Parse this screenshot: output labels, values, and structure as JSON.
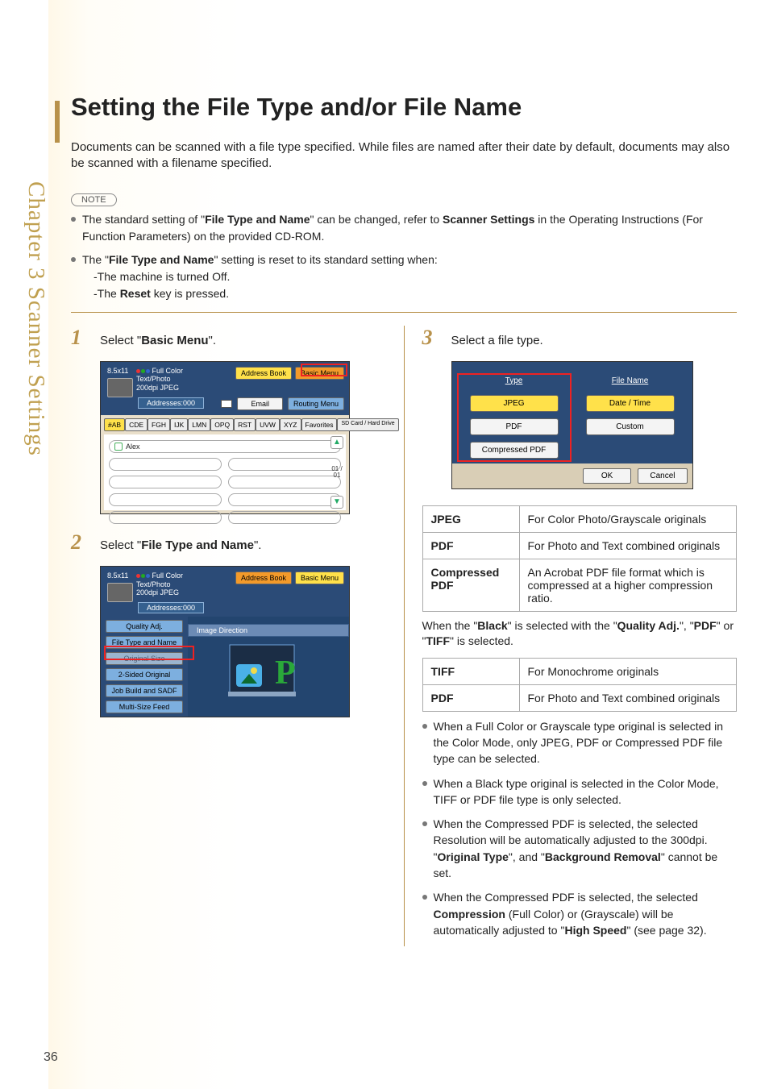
{
  "sidebar": "Chapter 3  Scanner Settings",
  "title": "Setting the File Type and/or File Name",
  "intro": "Documents can be scanned with a file type specified. While files are named after their date by default, documents may also be scanned with a filename specified.",
  "note_label": "NOTE",
  "notes": [
    {
      "text_pre": "The standard setting of \"",
      "b1": "File Type and Name",
      "text_mid": "\" can be changed, refer to ",
      "b2": "Scanner Settings",
      "text_post": " in the Operating Instructions (For Function Parameters) on the provided CD-ROM."
    },
    {
      "text_pre": "The \"",
      "b1": "File Type and Name",
      "text_mid": "\" setting is reset to its standard setting when:",
      "subs": [
        "-The machine is turned Off.",
        {
          "pre": "-The ",
          "b": "Reset",
          "post": " key is pressed."
        }
      ]
    }
  ],
  "steps": {
    "s1_num": "1",
    "s1_pre": "Select \"",
    "s1_bold": "Basic Menu",
    "s1_post": "\".",
    "s2_num": "2",
    "s2_pre": "Select \"",
    "s2_bold": "File Type and Name",
    "s2_post": "\".",
    "s3_num": "3",
    "s3_text": "Select a file type."
  },
  "ui1": {
    "size": "8.5x11",
    "full_color": "Full Color",
    "text_photo": "Text/Photo",
    "dpi": "200dpi JPEG",
    "addresses": "Addresses:000",
    "address_book": "Address Book",
    "basic_menu": "Basic Menu",
    "email": "Email",
    "routing_menu": "Routing Menu",
    "tabs": [
      "#AB",
      "CDE",
      "FGH",
      "IJK",
      "LMN",
      "OPQ",
      "RST",
      "UVW",
      "XYZ",
      "Favorites",
      "SD Card / Hard Drive"
    ],
    "row_name": "Alex",
    "page_ind": "01 / 01"
  },
  "ui2": {
    "size": "8.5x11",
    "full_color": "Full Color",
    "text_photo": "Text/Photo",
    "dpi": "200dpi JPEG",
    "addresses": "Addresses:000",
    "address_book": "Address Book",
    "basic_menu": "Basic Menu",
    "image_direction": "Image Direction",
    "menu": [
      "Quality Adj.",
      "File Type and Name",
      "Original Size",
      "2-Sided Original",
      "Job Build and SADF",
      "Multi-Size Feed"
    ]
  },
  "ui3": {
    "type_head": "Type",
    "filename_head": "File Name",
    "jpeg": "JPEG",
    "datetime": "Date / Time",
    "pdf": "PDF",
    "custom": "Custom",
    "cpdf": "Compressed PDF",
    "ok": "OK",
    "cancel": "Cancel"
  },
  "table1": [
    {
      "h": "JPEG",
      "d": "For Color Photo/Grayscale originals"
    },
    {
      "h": "PDF",
      "d": "For Photo and Text combined originals"
    },
    {
      "h": "Compressed PDF",
      "d": "An Acrobat PDF file format which is compressed at a higher compression ratio."
    }
  ],
  "mid_note": {
    "pre": "When the \"",
    "b1": "Black",
    "mid1": "\" is selected with the \"",
    "b2": "Quality Adj.",
    "mid2": "\", \"",
    "b3": "PDF",
    "mid3": "\" or \"",
    "b4": "TIFF",
    "post": "\" is selected."
  },
  "table2": [
    {
      "h": "TIFF",
      "d": "For Monochrome originals"
    },
    {
      "h": "PDF",
      "d": "For Photo and Text combined originals"
    }
  ],
  "bullets": [
    "When a Full Color or Grayscale type original is selected in the Color Mode, only JPEG, PDF or Compressed PDF file type can be selected.",
    "When a Black type original is selected in the Color Mode, TIFF or PDF file type is only selected."
  ],
  "bullet3": {
    "pre": "When the Compressed PDF is selected, the selected Resolution will be automatically adjusted to the 300dpi. \"",
    "b1": "Original Type",
    "mid": "\", and \"",
    "b2": "Background Removal",
    "post": "\" cannot be set."
  },
  "bullet4": {
    "pre": "When the Compressed PDF is selected, the selected ",
    "b1": "Compression",
    "mid": " (Full Color) or (Grayscale) will be automatically adjusted to \"",
    "b2": "High Speed",
    "post": "\" (see page 32)."
  },
  "page_number": "36"
}
